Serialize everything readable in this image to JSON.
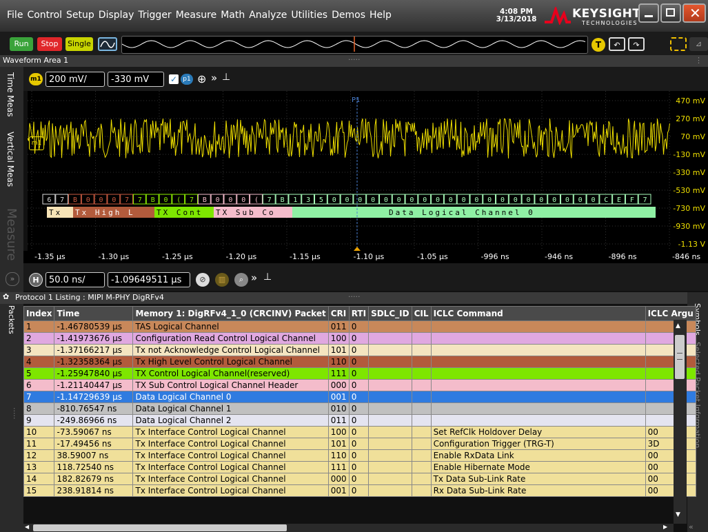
{
  "menu": {
    "items": [
      "File",
      "Control",
      "Setup",
      "Display",
      "Trigger",
      "Measure",
      "Math",
      "Analyze",
      "Utilities",
      "Demos",
      "Help"
    ]
  },
  "clock": {
    "time": "4:08 PM",
    "date": "3/13/2018"
  },
  "brand": {
    "name": "KEYSIGHT",
    "sub": "TECHNOLOGIES",
    "color": "#e8001c"
  },
  "toolbar": {
    "run": "Run",
    "stop": "Stop",
    "single": "Single",
    "trigger_badge": "T"
  },
  "waveform_area": {
    "title": "Waveform Area 1",
    "side_tabs": [
      "Time Meas",
      "Vertical Meas",
      "Measure"
    ],
    "channel_badge": "m1",
    "scale": "200 mV/",
    "offset": "-330 mV",
    "p_badge": "p1",
    "marker_label": "P1",
    "marker_ground": "m1",
    "v_labels": [
      "470 mV",
      "270 mV",
      "70 mV",
      "-130 mV",
      "-330 mV",
      "-530 mV",
      "-730 mV",
      "-930 mV",
      "-1.13 V"
    ],
    "t_labels": [
      "-1.35 µs",
      "-1.30 µs",
      "-1.25 µs",
      "-1.20 µs",
      "-1.15 µs",
      "-1.10 µs",
      "-1.05 µs",
      "-996 ns",
      "-946 ns",
      "-896 ns",
      "-846 ns"
    ],
    "bus_hex": [
      "6",
      "7",
      "B",
      "0",
      "0",
      "0",
      "7",
      "7",
      "B",
      "0",
      "(",
      "7",
      "B",
      "0",
      "0",
      "0",
      "(",
      "7",
      "B",
      "1",
      "3",
      "5",
      "0",
      "0",
      "0",
      "0",
      "0",
      "0",
      "0",
      "0",
      "0",
      "0",
      "0",
      "0",
      "0",
      "0",
      "0",
      "0",
      "0",
      "0",
      "0",
      "0",
      "0",
      "C",
      "E",
      "F",
      "7"
    ],
    "decode_segments": [
      {
        "text": "Tx",
        "color": "#f6e3b6"
      },
      {
        "text": "Tx High L",
        "color": "#b25b3c"
      },
      {
        "text": "TX Cont",
        "color": "#7ee600"
      },
      {
        "text": "TX Sub Co",
        "color": "#f4bccb"
      },
      {
        "text": "Data Logical Channel 0",
        "color": "#8ff0a4"
      }
    ],
    "timebase": "50.0 ns/",
    "delay": "-1.09649511 µs",
    "h_badge": "H"
  },
  "listing": {
    "title": "Protocol 1 Listing : MIPI M-PHY DigRFv4",
    "left_tab": "Packets",
    "right_tabs": [
      "Symbols",
      "Selected Packet Information"
    ],
    "columns": [
      "Index",
      "Time",
      "Memory 1: DigRFv4_1_0 (CRCINV) Packet",
      "CRI",
      "RTI",
      "SDLC_ID",
      "CIL",
      "ICLC Command",
      "ICLC Argu"
    ],
    "rows": [
      {
        "cells": [
          "1",
          "-1.46780539 µs",
          "TAS Logical Channel",
          "011",
          "0",
          "",
          "",
          "",
          ""
        ],
        "color": "#c8885a"
      },
      {
        "cells": [
          "2",
          "-1.41973676 µs",
          "Configuration Read Control Logical Channel",
          "100",
          "0",
          "",
          "",
          "",
          ""
        ],
        "color": "#e0a8e0"
      },
      {
        "cells": [
          "3",
          "-1.37166217 µs",
          "Tx not Acknowledge Control Logical Channel",
          "101",
          "0",
          "",
          "",
          "",
          ""
        ],
        "color": "#f4e4c0"
      },
      {
        "cells": [
          "4",
          "-1.32358364 µs",
          "Tx High Level Control Logical Channel",
          "110",
          "0",
          "",
          "",
          "",
          ""
        ],
        "color": "#b25b3c"
      },
      {
        "cells": [
          "5",
          "-1.25947840 µs",
          "TX Control Logical Channel(reserved)",
          "111",
          "0",
          "",
          "",
          "",
          ""
        ],
        "color": "#7ee600"
      },
      {
        "cells": [
          "6",
          "-1.21140447 µs",
          "TX Sub Control Logical Channel Header",
          "000",
          "0",
          "",
          "",
          "",
          ""
        ],
        "color": "#f4bccb"
      },
      {
        "cells": [
          "7",
          "-1.14729639 µs",
          "Data Logical Channel 0",
          "001",
          "0",
          "",
          "",
          "",
          ""
        ],
        "color": "#2f7be0"
      },
      {
        "cells": [
          "8",
          "-810.76547 ns",
          "Data Logical Channel 1",
          "010",
          "0",
          "",
          "",
          "",
          ""
        ],
        "color": "#c0c0c0"
      },
      {
        "cells": [
          "9",
          "-249.86966 ns",
          "Data Logical Channel 2",
          "011",
          "0",
          "",
          "",
          "",
          ""
        ],
        "color": "#e4e4f0"
      },
      {
        "cells": [
          "10",
          "-73.59067 ns",
          "Tx Interface Control Logical Channel",
          "100",
          "0",
          "",
          "",
          "Set RefClk Holdover Delay",
          "00"
        ],
        "color": "#f0e09a"
      },
      {
        "cells": [
          "11",
          "-17.49456 ns",
          "Tx Interface Control Logical Channel",
          "101",
          "0",
          "",
          "",
          "Configuration Trigger (TRG-T)",
          "3D"
        ],
        "color": "#f0e09a"
      },
      {
        "cells": [
          "12",
          "38.59007 ns",
          "Tx Interface Control Logical Channel",
          "110",
          "0",
          "",
          "",
          "Enable RxData Link",
          "00"
        ],
        "color": "#f0e09a"
      },
      {
        "cells": [
          "13",
          "118.72540 ns",
          "Tx Interface Control Logical Channel",
          "111",
          "0",
          "",
          "",
          "Enable Hibernate Mode",
          "00"
        ],
        "color": "#f0e09a"
      },
      {
        "cells": [
          "14",
          "182.82679 ns",
          "Tx Interface Control Logical Channel",
          "000",
          "0",
          "",
          "",
          "Tx Data Sub-Link Rate",
          "00"
        ],
        "color": "#f0e09a"
      },
      {
        "cells": [
          "15",
          "238.91814 ns",
          "Tx Interface Control Logical Channel",
          "001",
          "0",
          "",
          "",
          "Rx Data Sub-Link Rate",
          "00"
        ],
        "color": "#f0e09a"
      }
    ]
  }
}
